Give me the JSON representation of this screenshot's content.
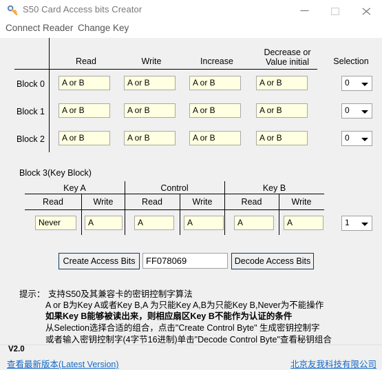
{
  "window": {
    "title": "S50 Card Access bits Creator",
    "icon": "key-icon",
    "controls": {
      "minimize": "minimize-icon",
      "maximize": "maximize-icon",
      "close": "close-icon"
    }
  },
  "menu": {
    "items": [
      {
        "label": "Connect Reader",
        "name": "menu-item-connect-reader"
      },
      {
        "label": "Change Key",
        "name": "menu-item-change-key"
      }
    ]
  },
  "main_table": {
    "headers": [
      "Read",
      "Write",
      "Increase",
      "Decrease or\nValue initial",
      "Selection"
    ],
    "header_decrease_line1": "Decrease or",
    "header_decrease_line2": "Value initial",
    "header_read": "Read",
    "header_write": "Write",
    "header_increase": "Increase",
    "header_selection": "Selection",
    "rows": [
      {
        "label": "Block 0",
        "read": "A or  B",
        "write": "A or  B",
        "increase": "A or  B",
        "decrease": "A or  B",
        "selection": "0"
      },
      {
        "label": "Block 1",
        "read": "A or  B",
        "write": "A or  B",
        "increase": "A or  B",
        "decrease": "A or  B",
        "selection": "0"
      },
      {
        "label": "Block 2",
        "read": "A or  B",
        "write": "A or  B",
        "increase": "A or  B",
        "decrease": "A or  B",
        "selection": "0"
      }
    ]
  },
  "key_block": {
    "title": "Block 3(Key Block)",
    "groups": [
      {
        "label": "Key A"
      },
      {
        "label": "Control"
      },
      {
        "label": "Key B"
      }
    ],
    "sub_headers": [
      "Read",
      "Write",
      "Read",
      "Write",
      "Read",
      "Write"
    ],
    "values": [
      "Never",
      "A",
      "A",
      "A",
      "A",
      "A"
    ],
    "selection": "1"
  },
  "actions": {
    "create_label": "Create Access Bits",
    "decode_label": "Decode Access Bits",
    "hex_value": "FF078069",
    "hex_placeholder": ""
  },
  "help": {
    "prefix": "提示：",
    "lines": [
      "支持S50及其兼容卡的密钥控制字算法",
      "A or B为Key A或者Key B,A 为只能Key A,B为只能Key B,Never为不能操作",
      "如果Key B能够被读出来，则相应扇区Key B不能作为认证的条件",
      "从Selection选择合适的组合，点击\"Create Control Byte\" 生成密钥控制字",
      "或者输入密钥控制字(4字节16进制)单击\"Decode Control Byte\"查看秘钥组合"
    ],
    "bold_index": 2
  },
  "status": {
    "version": "V2.0",
    "latest_link": "查看最新版本(Latest Version)",
    "company_link": "北京友我科技有限公司"
  },
  "colors": {
    "window_bg": "#f0f0f0",
    "titlebar_bg": "#ffffff",
    "field_bg": "#ffffe1",
    "field_border": "#a9a9a9",
    "button_border": "#10375c",
    "link": "#1569c7",
    "title_text": "#787878"
  }
}
